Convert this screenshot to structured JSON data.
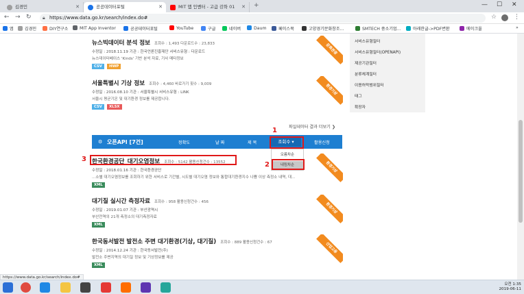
{
  "browser": {
    "tabs": [
      {
        "label": "김경민",
        "active": false,
        "favicon_color": "#9e9e9e"
      },
      {
        "label": "공공데이터포털",
        "active": true,
        "favicon_color": "#1a73e8"
      },
      {
        "label": "MIT 앱 인벤터 - 고급 강좌 01",
        "active": false,
        "favicon_color": "#ff0000"
      }
    ],
    "new_tab": "+",
    "window_controls": {
      "minimize": "—",
      "maximize": "☐",
      "close": "✕"
    },
    "url": "https://www.data.go.kr/search/index.do#",
    "bookmarks": [
      {
        "label": "앱",
        "color": "#1a73e8"
      },
      {
        "label": "김경민",
        "color": "#9e9e9e"
      },
      {
        "label": "DIY연구소",
        "color": "#ff7043"
      },
      {
        "label": "MIT App Inventor",
        "color": "#5f6368"
      },
      {
        "label": "공공데이터포털",
        "color": "#1a73e8"
      },
      {
        "label": "YouTube",
        "color": "#ff0000"
      },
      {
        "label": "구글",
        "color": "#4285f4"
      },
      {
        "label": "네이버",
        "color": "#03c75a"
      },
      {
        "label": "Daum",
        "color": "#1e88e5"
      },
      {
        "label": "페이스북",
        "color": "#3b5998"
      },
      {
        "label": "고양경기문화창조...",
        "color": "#333333"
      },
      {
        "label": "SMTECH 중소기업...",
        "color": "#2e7d32"
      },
      {
        "label": "아래한글->PDF변환",
        "color": "#00acc1"
      },
      {
        "label": "메이크올",
        "color": "#8e24aa"
      }
    ],
    "more_bookmarks": "»"
  },
  "sidebar": {
    "links": [
      "서비스유형필터",
      "서비스유형필터(OPENAPI)",
      "제공기관필터",
      "분류체계필터",
      "이용허락범위필터",
      "태그",
      "확장자"
    ]
  },
  "file_items": [
    {
      "title": "뉴스빅데이터 분석 정보",
      "stats": "조회수 : 1,493   다운로드수 : 23,833",
      "meta": "수정일 : 2018.11.19    기관 : 한국언론진흥재단    서비스유형 : 다운로드",
      "desc": "뉴스데이터베이스 'Kinds' 기반 분석 자료, 기사 메타정보",
      "badges": [
        {
          "label": "CSV",
          "color": "#4fb0e8"
        },
        {
          "label": "HWP",
          "color": "#f0a030"
        }
      ],
      "ribbon": "문화관광"
    },
    {
      "title": "서울특별시 기상 정보",
      "stats": "조회수 : 4,460   바로가기 횟수 : 9,009",
      "meta": "수정일 : 2016.08.10    기관 : 서울특별시    서비스유형 : LINK",
      "desc": "서울시 평균기온 및 대기환경 정보를 제공합니다.",
      "badges": [
        {
          "label": "CSV",
          "color": "#4fb0e8"
        },
        {
          "label": "XLSX",
          "color": "#e85a5a"
        }
      ],
      "ribbon": "환경기상"
    }
  ],
  "file_more_link": "파일데이터 결과 더보기 ❯",
  "api_section": {
    "title": "오픈API [7건]",
    "columns": [
      "정확도",
      "날  짜",
      "제  목"
    ],
    "sort_button": "조회수 ▾",
    "apply_button": "활용신청",
    "dropdown_options": [
      "오름차순",
      "내림차순"
    ]
  },
  "api_items": [
    {
      "title": "한국환경공단_대기오염정보",
      "stats": "조회수 : 5142   활용신청건수 : 13552",
      "meta": "수정일 : 2018.01.16    기관 : 한국환경공단",
      "desc": "...소별 대기오염정보를 조회하기 위한 서비스로 기간별, 시도별 대기오염 정보와 통합대기환경지수 나쁨 이상 측정소 내역, 대...",
      "badge": {
        "label": "XML",
        "color": "#3a8c5c"
      },
      "ribbon": "환경기상"
    },
    {
      "title": "대기질 실시간 측정자료",
      "stats": "조회수 : 958   활용신청건수 : 456",
      "meta": "수정일 : 2019.01.07    기관 : 부산광역시",
      "desc": "부산전역의 21개 측정소의 대기측정자료",
      "badge": {
        "label": "XML",
        "color": "#3a8c5c"
      },
      "ribbon": "환경기상"
    },
    {
      "title": "한국동서발전 발전소 주변 대기환경(기상, 대기질)",
      "stats": "조회수 : 889   활용신청건수 : 67",
      "meta": "수정일 : 2014.12.24    기관 : 한국동서발전(주)",
      "desc": "발전소 주변지역의 대기질 정보 및 기상정보를 제공",
      "badge": {
        "label": "XML",
        "color": "#3a8c5c"
      },
      "ribbon": "산업고용"
    }
  ],
  "annotations": [
    "1",
    "2",
    "3"
  ],
  "status_url": "https://www.data.go.kr/search/index.do#",
  "taskbar": {
    "time": "오전 1:35",
    "date": "2019-06-11"
  }
}
